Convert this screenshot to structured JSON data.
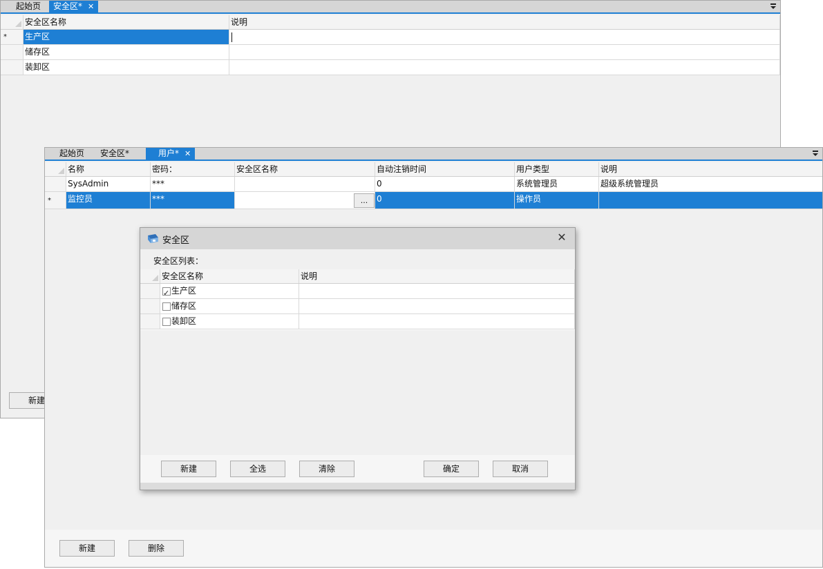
{
  "back_window": {
    "tabs": [
      {
        "label": "起始页",
        "active": false,
        "closable": false
      },
      {
        "label": "安全区*",
        "active": true,
        "closable": true
      }
    ],
    "grid": {
      "columns": [
        "安全区名称",
        "说明"
      ],
      "new_row_marker": "*",
      "rows": [
        {
          "name": "生产区",
          "desc": "",
          "selected": true
        },
        {
          "name": "储存区",
          "desc": "",
          "selected": false
        },
        {
          "name": "装卸区",
          "desc": "",
          "selected": false
        }
      ]
    },
    "new_button": "新建"
  },
  "front_window": {
    "tabs": [
      {
        "label": "起始页",
        "active": false,
        "closable": false
      },
      {
        "label": "安全区*",
        "active": false,
        "closable": false
      },
      {
        "label": "用户*",
        "active": true,
        "closable": true
      }
    ],
    "grid": {
      "columns": [
        "名称",
        "密码：",
        "安全区名称",
        "自动注销时间",
        "用户类型",
        "说明"
      ],
      "new_row_marker": "*",
      "rows": [
        {
          "name": "SysAdmin",
          "password": "***",
          "zone": "",
          "timeout": "0",
          "type": "系统管理员",
          "desc": "超级系统管理员",
          "selected": false
        },
        {
          "name": "监控员",
          "password": "***",
          "zone": "",
          "timeout": "0",
          "type": "操作员",
          "desc": "",
          "selected": true
        }
      ],
      "ellipsis_button": "..."
    },
    "new_button": "新建",
    "delete_button": "删除"
  },
  "dialog": {
    "title": "安全区",
    "list_label": "安全区列表：",
    "columns": [
      "安全区名称",
      "说明"
    ],
    "rows": [
      {
        "name": "生产区",
        "desc": "",
        "checked": true
      },
      {
        "name": "储存区",
        "desc": "",
        "checked": false
      },
      {
        "name": "装卸区",
        "desc": "",
        "checked": false
      }
    ],
    "buttons": {
      "new": "新建",
      "select_all": "全选",
      "clear": "清除",
      "ok": "确定",
      "cancel": "取消"
    }
  },
  "colors": {
    "accent": "#1e7fd4",
    "panel": "#f0f0f0",
    "tabstrip": "#d6d6d6"
  },
  "icons": [
    "close-icon",
    "tab-menu-icon",
    "dialog-app-icon",
    "checkbox-icon"
  ]
}
